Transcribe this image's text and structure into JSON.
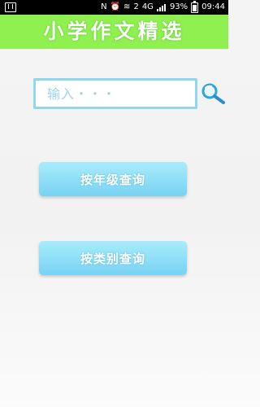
{
  "status_bar": {
    "network": "4G",
    "sim": "2",
    "battery": "93%",
    "time": "09:44"
  },
  "header": {
    "title": "小学作文精选"
  },
  "search": {
    "placeholder": "输入・・・"
  },
  "buttons": {
    "by_grade": "按年级查询",
    "by_type": "按类别查询"
  },
  "icons": {
    "search": "magnifier-icon",
    "status_left": "gallery-icon",
    "nfc": "nfc-icon",
    "alarm": "alarm-icon",
    "wifi": "wifi-icon",
    "signal": "signal-icon",
    "battery": "battery-icon"
  },
  "colors": {
    "header": "#8ff04f",
    "button": "#78d2f3",
    "input_border": "#8fd7ef"
  }
}
